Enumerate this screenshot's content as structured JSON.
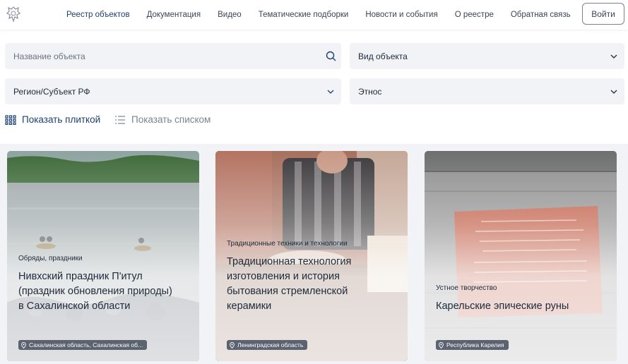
{
  "header": {
    "logo_icon": "coat-of-arms-icon",
    "nav": [
      {
        "label": "Реестр объектов",
        "active": true
      },
      {
        "label": "Документация"
      },
      {
        "label": "Видео"
      },
      {
        "label": "Тематические подборки"
      },
      {
        "label": "Новости и события"
      },
      {
        "label": "О реестре"
      },
      {
        "label": "Обратная связь"
      }
    ],
    "login_label": "Войти"
  },
  "filters": {
    "search_placeholder": "Название объекта",
    "search_icon": "search-icon",
    "object_type": "Вид объекта",
    "region": "Регион/Субъект РФ",
    "ethnos": "Этнос",
    "dropdown_icon": "chevron-down-icon"
  },
  "view": {
    "tile_label": "Показать плиткой",
    "list_label": "Показать списком",
    "active": "tile"
  },
  "cards": [
    {
      "category": "Обряды, праздники",
      "title_lines": [
        "Нивхский праздник П'итул",
        "(праздник обновления природы)",
        "в Сахалинской области"
      ],
      "location": "Сахалинская область, Сахалинская об..."
    },
    {
      "category": "Традиционные техники и технологии",
      "title_lines": [
        "Традиционная технология",
        "изготовления и история",
        "бытования стремленской",
        "керамики"
      ],
      "location": "Ленинградская область"
    },
    {
      "category": "Устное творчество",
      "title_lines": [
        "Карельские эпические руны"
      ],
      "location": "Республика Карелия"
    }
  ],
  "colors": {
    "accent": "#1d3f73",
    "filter_bg": "#f1f3f6",
    "badge_bg": "#5b6270"
  }
}
